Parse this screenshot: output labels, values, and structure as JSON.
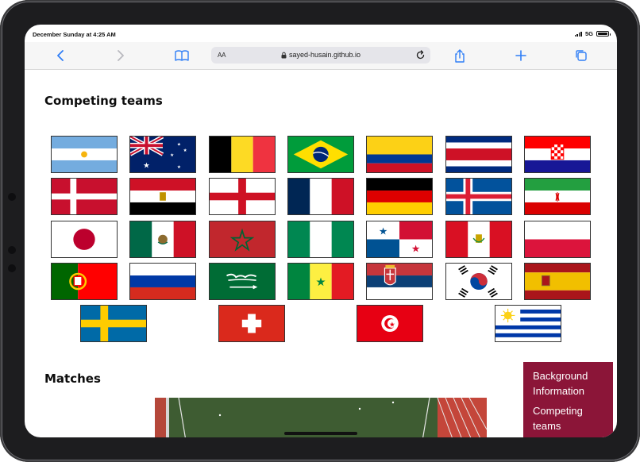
{
  "status_bar": {
    "time": "December Sunday at 4:25 AM",
    "network": "5G"
  },
  "toolbar": {
    "back_icon": "chevron-left-icon",
    "forward_icon": "chevron-right-icon",
    "bookmarks_icon": "book-icon",
    "text_size_label": "AA",
    "url": "sayed-husain.github.io",
    "lock_icon": "lock-icon",
    "reload_icon": "reload-icon",
    "share_icon": "share-icon",
    "new_tab_icon": "plus-icon",
    "tabs_icon": "tabs-icon"
  },
  "sections": {
    "teams_title": "Competing teams",
    "matches_title": "Matches"
  },
  "teams": [
    "Argentina",
    "Australia",
    "Belgium",
    "Brazil",
    "Colombia",
    "Costa Rica",
    "Croatia",
    "Denmark",
    "Egypt",
    "England",
    "France",
    "Germany",
    "Iceland",
    "Iran",
    "Japan",
    "Mexico",
    "Morocco",
    "Nigeria",
    "Panama",
    "Peru",
    "Poland",
    "Portugal",
    "Russia",
    "Saudi Arabia",
    "Senegal",
    "Serbia",
    "South Korea",
    "Spain",
    "Sweden",
    "Switzerland",
    "Tunisia",
    "Uruguay"
  ],
  "side_nav": {
    "item1": "Background Information",
    "item2": "Competing teams"
  },
  "colors": {
    "accent": "#2f7ef6",
    "side_nav_bg": "#8b1538"
  }
}
